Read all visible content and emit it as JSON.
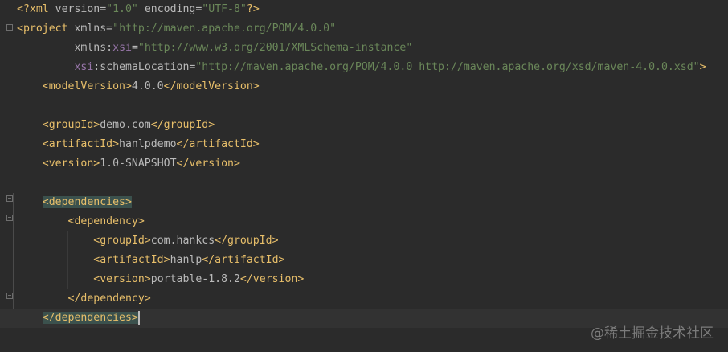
{
  "editor": {
    "language": "XML",
    "lines": [
      {
        "id": "xml-decl",
        "parts": [
          {
            "c": "tag",
            "t": "<?xml "
          },
          {
            "c": "attr",
            "t": "version"
          },
          {
            "c": "text",
            "t": "="
          },
          {
            "c": "str",
            "t": "\"1.0\""
          },
          {
            "c": "attr",
            "t": " encoding"
          },
          {
            "c": "text",
            "t": "="
          },
          {
            "c": "str",
            "t": "\"UTF-8\""
          },
          {
            "c": "tag",
            "t": "?>"
          }
        ]
      },
      {
        "id": "project-open",
        "parts": [
          {
            "c": "tag",
            "t": "<project "
          },
          {
            "c": "attr",
            "t": "xmlns"
          },
          {
            "c": "text",
            "t": "="
          },
          {
            "c": "str",
            "t": "\"http://maven.apache.org/POM/4.0.0\""
          }
        ]
      },
      {
        "id": "xmlns-xsi",
        "parts": [
          {
            "c": "text",
            "t": "         "
          },
          {
            "c": "attr",
            "t": "xmlns"
          },
          {
            "c": "text",
            "t": ":"
          },
          {
            "c": "ns",
            "t": "xsi"
          },
          {
            "c": "text",
            "t": "="
          },
          {
            "c": "str",
            "t": "\"http://www.w3.org/2001/XMLSchema-instance\""
          }
        ]
      },
      {
        "id": "schema-location",
        "parts": [
          {
            "c": "text",
            "t": "         "
          },
          {
            "c": "ns",
            "t": "xsi"
          },
          {
            "c": "text",
            "t": ":"
          },
          {
            "c": "attr",
            "t": "schemaLocation"
          },
          {
            "c": "text",
            "t": "="
          },
          {
            "c": "str",
            "t": "\"http://maven.apache.org/POM/4.0.0 http://maven.apache.org/xsd/maven-4.0.0.xsd\""
          },
          {
            "c": "tag",
            "t": ">"
          }
        ]
      },
      {
        "id": "model-version",
        "parts": [
          {
            "c": "text",
            "t": "    "
          },
          {
            "c": "tag",
            "t": "<modelVersion>"
          },
          {
            "c": "text",
            "t": "4.0.0"
          },
          {
            "c": "tag",
            "t": "</modelVersion>"
          }
        ]
      },
      {
        "id": "blank-1",
        "parts": []
      },
      {
        "id": "group-id",
        "parts": [
          {
            "c": "text",
            "t": "    "
          },
          {
            "c": "tag",
            "t": "<groupId>"
          },
          {
            "c": "text",
            "t": "demo.com"
          },
          {
            "c": "tag",
            "t": "</groupId>"
          }
        ]
      },
      {
        "id": "artifact-id",
        "parts": [
          {
            "c": "text",
            "t": "    "
          },
          {
            "c": "tag",
            "t": "<artifactId>"
          },
          {
            "c": "text",
            "t": "hanlpdemo"
          },
          {
            "c": "tag",
            "t": "</artifactId>"
          }
        ]
      },
      {
        "id": "version",
        "parts": [
          {
            "c": "text",
            "t": "    "
          },
          {
            "c": "tag",
            "t": "<version>"
          },
          {
            "c": "text",
            "t": "1.0-SNAPSHOT"
          },
          {
            "c": "tag",
            "t": "</version>"
          }
        ]
      },
      {
        "id": "blank-2",
        "parts": []
      },
      {
        "id": "dependencies-open",
        "parts": [
          {
            "c": "text",
            "t": "    "
          },
          {
            "c": "tag hl",
            "t": "<dependencies>"
          }
        ]
      },
      {
        "id": "dependency-open",
        "parts": [
          {
            "c": "text",
            "t": "        "
          },
          {
            "c": "tag",
            "t": "<dependency>"
          }
        ]
      },
      {
        "id": "dep-group-id",
        "parts": [
          {
            "c": "text",
            "t": "            "
          },
          {
            "c": "tag",
            "t": "<groupId>"
          },
          {
            "c": "text",
            "t": "com.hankcs"
          },
          {
            "c": "tag",
            "t": "</groupId>"
          }
        ]
      },
      {
        "id": "dep-artifact-id",
        "parts": [
          {
            "c": "text",
            "t": "            "
          },
          {
            "c": "tag",
            "t": "<artifactId>"
          },
          {
            "c": "text",
            "t": "hanlp"
          },
          {
            "c": "tag",
            "t": "</artifactId>"
          }
        ]
      },
      {
        "id": "dep-version",
        "parts": [
          {
            "c": "text",
            "t": "            "
          },
          {
            "c": "tag",
            "t": "<version>"
          },
          {
            "c": "text",
            "t": "portable-1.8.2"
          },
          {
            "c": "tag",
            "t": "</version>"
          }
        ]
      },
      {
        "id": "dependency-close",
        "parts": [
          {
            "c": "text",
            "t": "        "
          },
          {
            "c": "tag",
            "t": "</dependency>"
          }
        ]
      },
      {
        "id": "dependencies-close",
        "parts": [
          {
            "c": "text",
            "t": "    "
          },
          {
            "c": "tag hl",
            "t": "</dependencies>"
          }
        ]
      }
    ]
  },
  "watermark": {
    "text": "@稀土掘金技术社区"
  }
}
